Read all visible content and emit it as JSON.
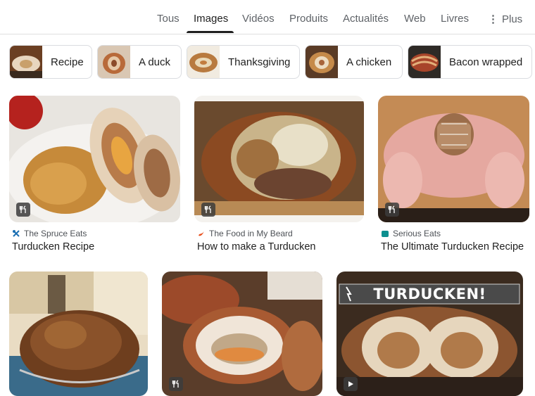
{
  "tabs": [
    {
      "label": "Tous"
    },
    {
      "label": "Images"
    },
    {
      "label": "Vidéos"
    },
    {
      "label": "Produits"
    },
    {
      "label": "Actualités"
    },
    {
      "label": "Web"
    },
    {
      "label": "Livres"
    },
    {
      "label": "Plus"
    }
  ],
  "active_tab": "Images",
  "chips": [
    {
      "label": "Recipe"
    },
    {
      "label": "A duck"
    },
    {
      "label": "Thanksgiving"
    },
    {
      "label": "A chicken"
    },
    {
      "label": "Bacon wrapped"
    }
  ],
  "results": [
    {
      "source": "The Spruce Eats",
      "title": "Turducken Recipe",
      "badge": "recipe-icon"
    },
    {
      "source": "The Food in My Beard",
      "title": "How to make a Turducken",
      "badge": "recipe-icon"
    },
    {
      "source": "Serious Eats",
      "title": "The Ultimate Turducken Recipe",
      "badge": "recipe-icon"
    },
    {
      "source": "",
      "title": "",
      "badge": ""
    },
    {
      "source": "",
      "title": "",
      "badge": "recipe-icon"
    },
    {
      "overlay_text": "TURDUCKEN!",
      "badge": "play-icon"
    }
  ],
  "colors": {
    "text_primary": "#1f1f1f",
    "text_secondary": "#5f6368",
    "border": "#dadce0"
  }
}
